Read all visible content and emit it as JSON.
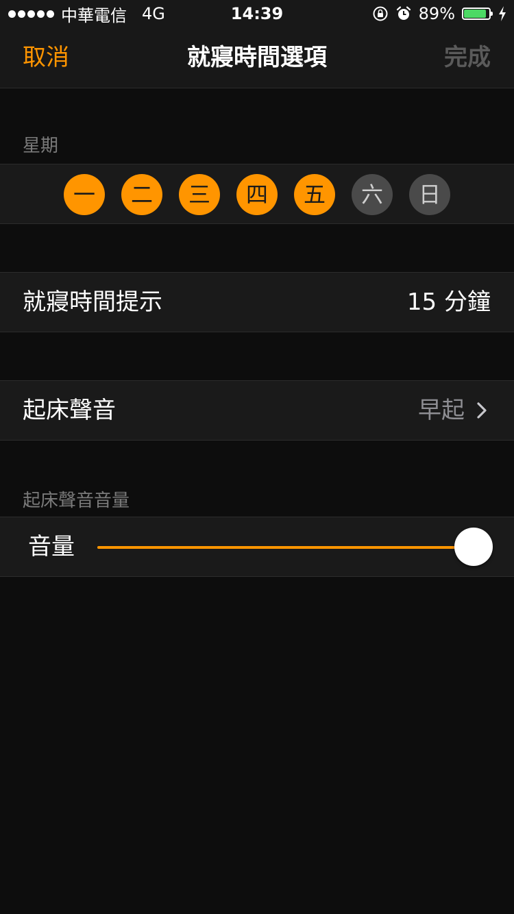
{
  "status_bar": {
    "carrier": "中華電信",
    "network": "4G",
    "time": "14:39",
    "battery_percent_text": "89%",
    "battery_level": 0.89,
    "icons": [
      "orientation-lock-icon",
      "alarm-icon",
      "charging-bolt-icon"
    ]
  },
  "nav": {
    "cancel_label": "取消",
    "title": "就寢時間選項",
    "done_label": "完成"
  },
  "weekday_section": {
    "header": "星期",
    "days": [
      {
        "label": "一",
        "selected": true
      },
      {
        "label": "二",
        "selected": true
      },
      {
        "label": "三",
        "selected": true
      },
      {
        "label": "四",
        "selected": true
      },
      {
        "label": "五",
        "selected": true
      },
      {
        "label": "六",
        "selected": false
      },
      {
        "label": "日",
        "selected": false
      }
    ]
  },
  "bedtime_reminder": {
    "label": "就寢時間提示",
    "value": "15 分鐘"
  },
  "wake_sound": {
    "label": "起床聲音",
    "value": "早起"
  },
  "volume_section": {
    "header": "起床聲音音量",
    "label": "音量",
    "level": 1.0
  },
  "colors": {
    "accent": "#ff9500",
    "background": "#0d0d0d",
    "row_background": "#1a1a1a",
    "day_off": "#4a4a4a",
    "battery_green": "#4cd964"
  }
}
